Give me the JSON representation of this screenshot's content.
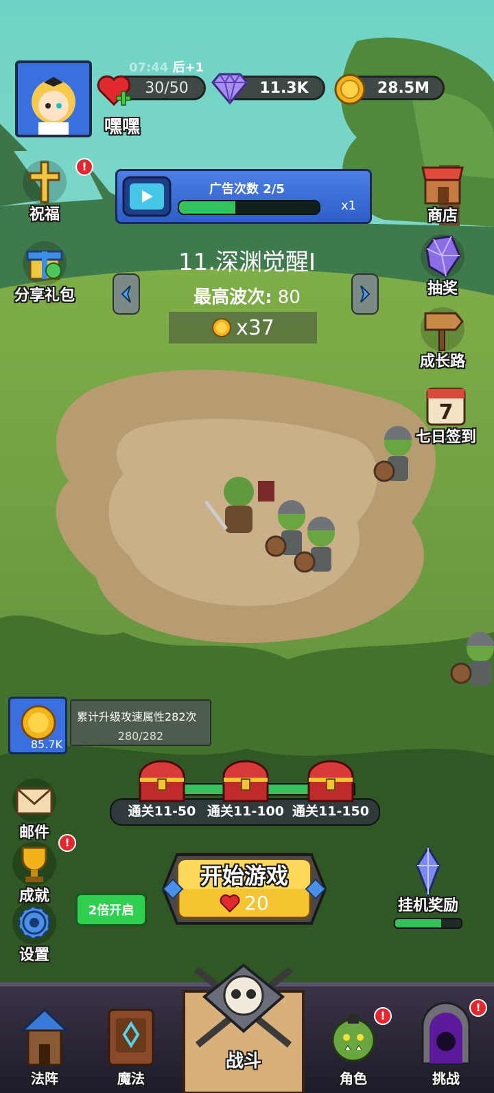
{
  "player": {
    "name": "嘿嘿",
    "stamina_timer": "07:44",
    "stamina_timer_suffix": "后+1",
    "stamina": "30/50",
    "gems": "11.3K",
    "gold": "28.5M"
  },
  "ad_banner": {
    "label": "广告次数 2/5",
    "multiplier": "x1",
    "progress": 0.4
  },
  "stage": {
    "title": "11.深渊觉醒I",
    "best_wave_label": "最高波次:",
    "best_wave_value": "80",
    "reward": "x37"
  },
  "left_menu": {
    "bless": "祝福",
    "share_gift": "分享礼包"
  },
  "right_menu": {
    "shop": "商店",
    "lottery": "抽奖",
    "growth": "成长路",
    "seven_day": "七日签到"
  },
  "upgrade_card": {
    "coin_value": "85.7K",
    "text": "累计升级攻速属性282次",
    "progress": "280/282"
  },
  "chests": [
    {
      "label": "通关11-50"
    },
    {
      "label": "通关11-100"
    },
    {
      "label": "通关11-150"
    }
  ],
  "bottom_left": {
    "mail": "邮件",
    "achievement": "成就",
    "settings": "设置",
    "double_speed": "2倍开启"
  },
  "start": {
    "label": "开始游戏",
    "cost": "20"
  },
  "idle_reward": {
    "label": "挂机奖励",
    "progress": 0.7
  },
  "nav": {
    "formation": "法阵",
    "magic": "魔法",
    "battle": "战斗",
    "character": "角色",
    "challenge": "挑战"
  },
  "colors": {
    "accent_blue": "#2f6fd1",
    "start_yellow": "#f6c431",
    "badge_red": "#e4262e",
    "progress_green": "#36c25a"
  }
}
